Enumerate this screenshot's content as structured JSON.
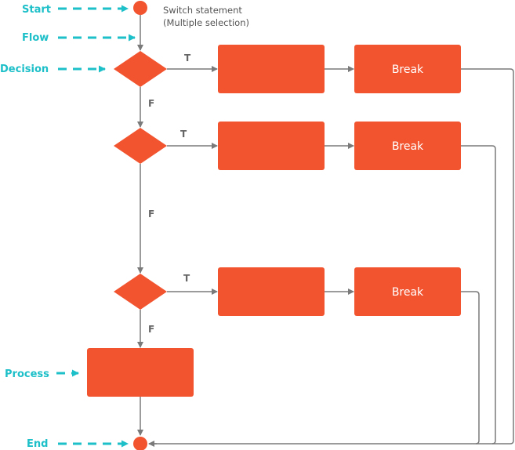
{
  "title_note": {
    "line1": "Switch statement",
    "line2": "(Multiple selection)"
  },
  "colors": {
    "shape_fill": "#F25430",
    "legend_teal": "#1DBFC8",
    "connector": "#7A7A7A",
    "branch_label": "#666666"
  },
  "legend": {
    "start": "Start",
    "flow": "Flow",
    "decision": "Decision",
    "process": "Process",
    "end": "End"
  },
  "branches": [
    {
      "true_label": "T",
      "false_label": "F",
      "break_label": "Break"
    },
    {
      "true_label": "T",
      "false_label": "F",
      "break_label": "Break"
    },
    {
      "true_label": "T",
      "false_label": "F",
      "break_label": "Break"
    }
  ]
}
